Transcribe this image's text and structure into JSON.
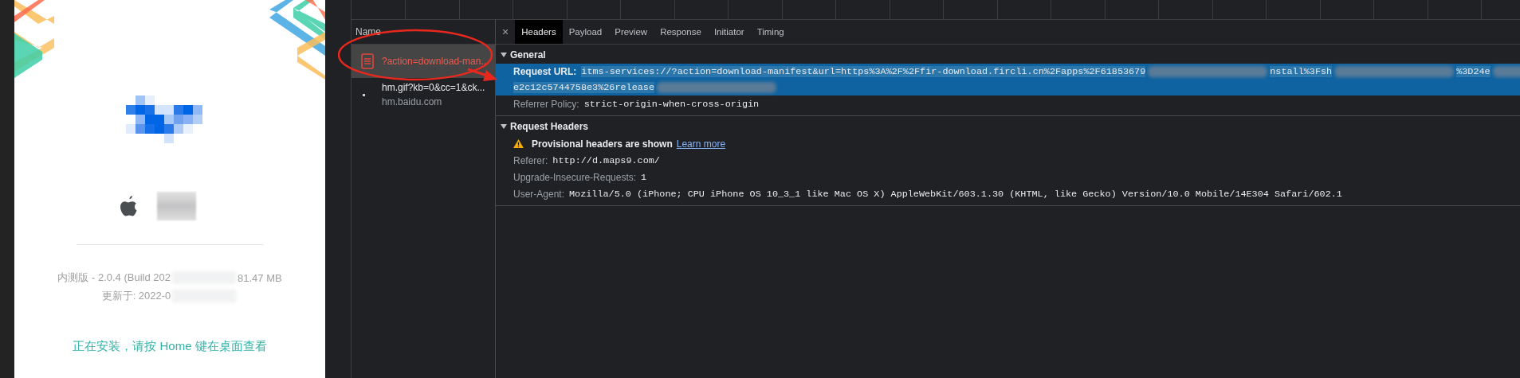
{
  "phone_page": {
    "version_parts": [
      "内测版 - 2.0.4 (Build 202",
      "81.47 MB"
    ],
    "updated_parts": [
      "更新于: 2022-0"
    ],
    "install_hint": "正在安装，请按 Home 键在桌面查看"
  },
  "network": {
    "name_header": "Name",
    "requests": [
      {
        "kind": "document",
        "name": "?action=download-man...",
        "selected": true,
        "error": true
      },
      {
        "kind": "image",
        "name": "hm.gif?kb=0&cc=1&ck...",
        "domain": "hm.baidu.com",
        "selected": false,
        "error": false
      }
    ]
  },
  "details": {
    "close": "×",
    "tabs": [
      {
        "label": "Headers",
        "selected": true
      },
      {
        "label": "Payload",
        "selected": false
      },
      {
        "label": "Preview",
        "selected": false
      },
      {
        "label": "Response",
        "selected": false
      },
      {
        "label": "Initiator",
        "selected": false
      },
      {
        "label": "Timing",
        "selected": false
      }
    ],
    "sections": [
      {
        "title": "General",
        "expanded": true,
        "rows": [
          {
            "kind": "redacted",
            "name": "Request URL:",
            "highlighted": true,
            "lines": [
              [
                "itms-services://?action=download-manifest&url=https%3A%2F%2Ffir-download.fircli.cn%2Fapps%2F61853679",
                "nstall%3Fsh",
                "%3D24e"
              ],
              [
                "e2c12c5744758e3%26release"
              ]
            ]
          },
          {
            "kind": "field",
            "name": "Referrer Policy:",
            "value": "strict-origin-when-cross-origin",
            "highlighted": false
          }
        ]
      },
      {
        "title": "Request Headers",
        "expanded": true,
        "rows": [
          {
            "kind": "warning",
            "text": "Provisional headers are shown",
            "link": "Learn more"
          },
          {
            "kind": "field",
            "name": "Referer:",
            "value": "http://d.maps9.com/",
            "highlighted": false
          },
          {
            "kind": "field",
            "name": "Upgrade-Insecure-Requests:",
            "value": "1",
            "highlighted": false
          },
          {
            "kind": "field",
            "name": "User-Agent:",
            "value": "Mozilla/5.0 (iPhone; CPU iPhone OS 10_3_1 like Mac OS X) AppleWebKit/603.1.30 (KHTML, like Gecko) Version/10.0 Mobile/14E304 Safari/602.1",
            "highlighted": false
          }
        ]
      }
    ]
  }
}
